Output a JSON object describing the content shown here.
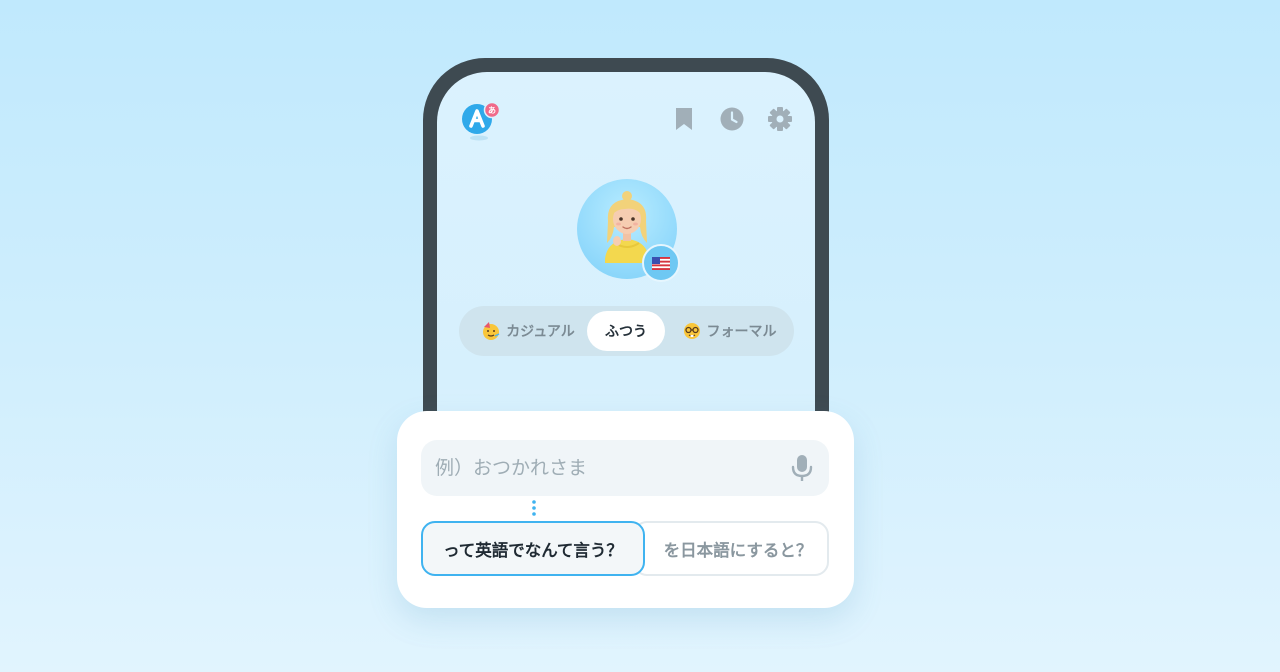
{
  "header": {
    "logo_icon": "app-logo-icon",
    "logo_badge": "あ",
    "actions": [
      {
        "name": "bookmark-icon"
      },
      {
        "name": "history-icon"
      },
      {
        "name": "settings-icon"
      }
    ]
  },
  "profile": {
    "avatar": "character-avatar",
    "language_flag": "us-flag-icon"
  },
  "tones": [
    {
      "label": "カジュアル",
      "emoji": "party-face-icon",
      "selected": false
    },
    {
      "label": "ふつう",
      "selected": true
    },
    {
      "label": "フォーマル",
      "emoji": "nerd-face-icon",
      "selected": false
    }
  ],
  "input": {
    "value": "",
    "placeholder": "例）おつかれさま",
    "mic_icon": "microphone-icon"
  },
  "suggestions": [
    {
      "label": "って英語でなんて言う？",
      "selected": true
    },
    {
      "label": "を日本語にすると？",
      "selected": false
    }
  ],
  "colors": {
    "accent": "#3fb3f0",
    "phone_frame": "#3e4a51",
    "background_top": "#c0e9fd",
    "logo_badge": "#f06a8a"
  }
}
